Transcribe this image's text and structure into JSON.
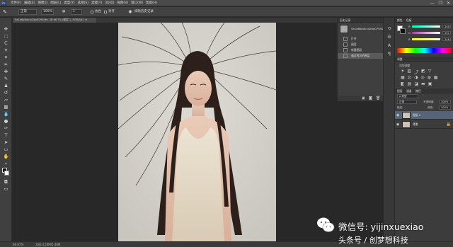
{
  "menubar": {
    "logo": "Ps",
    "menus": [
      "文件(F)",
      "编辑(E)",
      "图像(I)",
      "图层(L)",
      "类型(Y)",
      "选择(S)",
      "滤镜(T)",
      "3D(D)",
      "视图(V)",
      "窗口(W)",
      "帮助(H)"
    ],
    "minimize": "—",
    "restore": "❐",
    "close": "✕"
  },
  "optbar": {
    "mode": "正常",
    "opacity": "100%",
    "setting": "1",
    "sample_label": "仿色",
    "align_label": "对齐",
    "pressure_label": "抹除历史记录"
  },
  "tab": {
    "title": "5a1a6b6dc4d2bd07940fe...@ 66.7% (图层 1, RGB/8#)",
    "close": "×"
  },
  "statusbar": {
    "zoom": "66.67%",
    "doc": "文档:3.50M/5.48M"
  },
  "history": {
    "header": "历史记录",
    "snapshot": "5a1a6b6dc4d2bd07940fe...",
    "items": [
      "打开",
      "图层",
      "新建图层",
      "通过拷贝的图层"
    ]
  },
  "color": {
    "header_tabs": [
      "颜色",
      "色板"
    ],
    "channels": [
      {
        "label": "R",
        "value": "240"
      },
      {
        "label": "G",
        "value": "251"
      },
      {
        "label": "B",
        "value": "246"
      }
    ]
  },
  "adjustments": {
    "header": "调整",
    "add_label": "添加调整"
  },
  "layers": {
    "header_tabs": [
      "图层",
      "通道",
      "路径"
    ],
    "blend": "正常",
    "opacity_label": "不透明度:",
    "opacity": "100%",
    "lock_label": "锁定:",
    "fill_label": "填充:",
    "fill": "100%",
    "items": [
      {
        "name": "图层 1",
        "selected": true
      },
      {
        "name": "背景",
        "selected": false
      }
    ]
  },
  "watermark": {
    "line1": "微信号: yijinxuexiao",
    "line2": "头条号 / 创梦想科技"
  }
}
